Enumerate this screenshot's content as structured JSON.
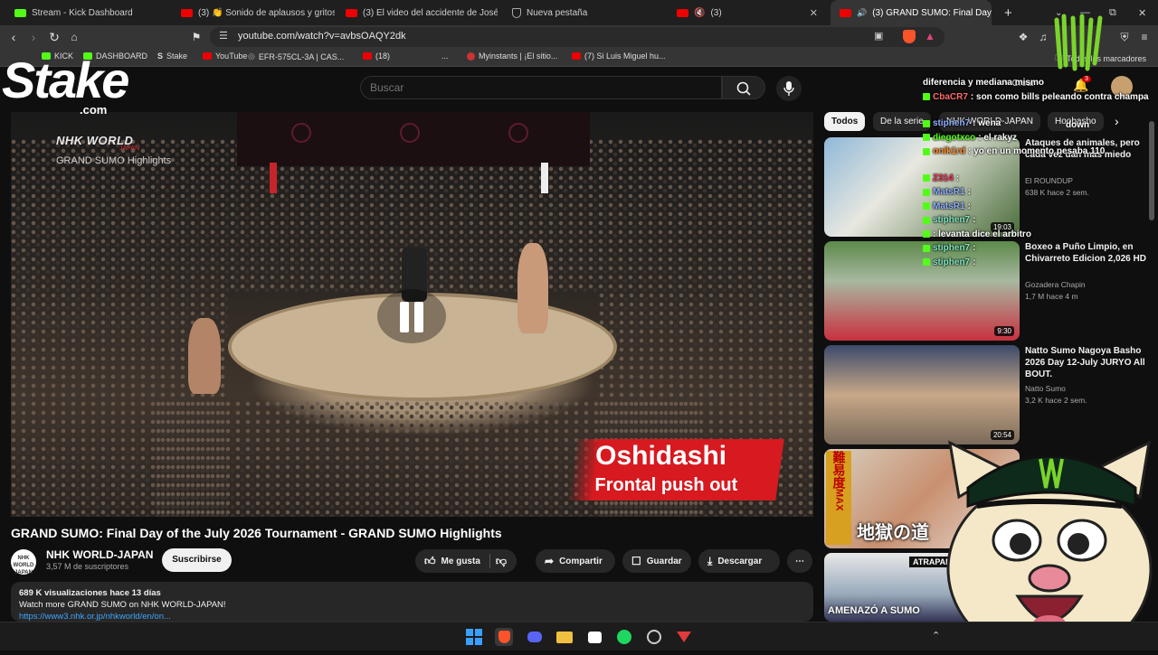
{
  "tabs": [
    {
      "label": "Stream - Kick Dashboard",
      "icon": "kick-icon"
    },
    {
      "label": "(3) 👏 Sonido de aplausos y gritos d",
      "icon": "youtube-icon"
    },
    {
      "label": "(3) El video del accidente de José An",
      "icon": "youtube-icon"
    },
    {
      "label": "Nueva pestaña",
      "icon": "brave-shield-icon"
    },
    {
      "label": "(3)",
      "icon": "youtube-icon"
    },
    {
      "label": "(3) GRAND SUMO: Final Day",
      "icon": "youtube-icon"
    }
  ],
  "address": {
    "url": "youtube.com/watch?v=avbsOAQY2dk"
  },
  "bookmarks": [
    {
      "label": "KICK"
    },
    {
      "label": "DASHBOARD"
    },
    {
      "label": "Stake"
    },
    {
      "label": "YouTube"
    },
    {
      "label": "EFR-575CL-3A | CAS..."
    },
    {
      "label": "(18)"
    },
    {
      "label": "..."
    },
    {
      "label": "Myinstants | ¡El sitio..."
    },
    {
      "label": "(7) Si Luis Miguel hu..."
    },
    {
      "label": "Todos los marcadores"
    }
  ],
  "youtube": {
    "search_placeholder": "Buscar",
    "create_label": "+ Crear",
    "notif_count": "3"
  },
  "video": {
    "bug_title": "NHK WORLD",
    "bug_sub": "JAPAN",
    "bug_show": "GRAND SUMO Highlights",
    "caption_line1": "Oshidashi",
    "caption_line2": "Frontal push out",
    "title": "GRAND SUMO: Final Day of the July 2026 Tournament - GRAND SUMO Highlights"
  },
  "channel": {
    "avatar_text": "NHK WORLD JAPAN",
    "name": "NHK WORLD-JAPAN",
    "subs": "3,57 M de suscriptores",
    "subscribe": "Suscribirse"
  },
  "actions": {
    "like": "Me gusta",
    "share": "Compartir",
    "save": "Guardar",
    "download": "Descargar"
  },
  "description": {
    "stats": "689 K visualizaciones  hace 13 días",
    "line1": "Watch more GRAND SUMO on NHK WORLD-JAPAN!",
    "link": "https://www3.nhk.or.jp/nhkworld/en/on..."
  },
  "chips": [
    "Todos",
    "De la serie",
    "NHK WORLD-JAPAN",
    "Hoobasho"
  ],
  "recommendations": [
    {
      "title": "Ataques de animales, pero cada vez dan más miedo",
      "channel": "El ROUNDUP",
      "stats": "638 K   hace 2 sem.",
      "duration": "19:03"
    },
    {
      "title": "Boxeo a Puño Limpio, en Chivarreto Edicion 2,026 HD",
      "channel": "Gozadera Chapin",
      "stats": "1,7 M   hace 4 m",
      "duration": "9:30"
    },
    {
      "title": "Natto Sumo Nagoya Basho 2026 Day 12-July JURYO All BOUT.",
      "channel": "Natto Sumo",
      "stats": "3,2 K   hace 2 sem.",
      "duration": "20:54"
    },
    {
      "title": "",
      "channel": "",
      "stats": "",
      "duration": ""
    },
    {
      "title": "",
      "channel": "",
      "stats": "",
      "duration": ""
    }
  ],
  "thumb_text": {
    "rec4_japanese": "地獄の道",
    "rec4_side": "難易度",
    "rec4_max": "MAX",
    "rec5_label": "ATRAPADOS",
    "rec5_bottom": "AMENAZÓ A SUMO"
  },
  "overlay": {
    "stake_logo": "Stake",
    "stake_com": ".com",
    "chat": [
      {
        "user": "",
        "text": "diferencia y mediana mismo"
      },
      {
        "user": "CbaCR7",
        "text": ": son como bills peleando contra champa"
      },
      {
        "user": "stiphen7",
        "text": ": wena"
      },
      {
        "user": "diegotxco",
        "text": ": el rakyz"
      },
      {
        "user": "onik1rd",
        "text": ": yo en un momento pesaba 110"
      },
      {
        "user": "Z314",
        "text": ":"
      },
      {
        "user": "MatsR1",
        "text": ":"
      },
      {
        "user": "MatsR1",
        "text": ":"
      },
      {
        "user": "stiphen7",
        "text": ":"
      },
      {
        "user": "",
        "text": ": levanta dice el arbitro"
      },
      {
        "user": "stiphen7",
        "text": ":"
      },
      {
        "user": "stiphen7",
        "text": ":"
      }
    ],
    "chat_tail": "down"
  },
  "colors": {
    "kick_green": "#53fc18",
    "youtube_red": "#ff0000",
    "nhk_red": "#d71920",
    "bg": "#0f0f0f"
  }
}
